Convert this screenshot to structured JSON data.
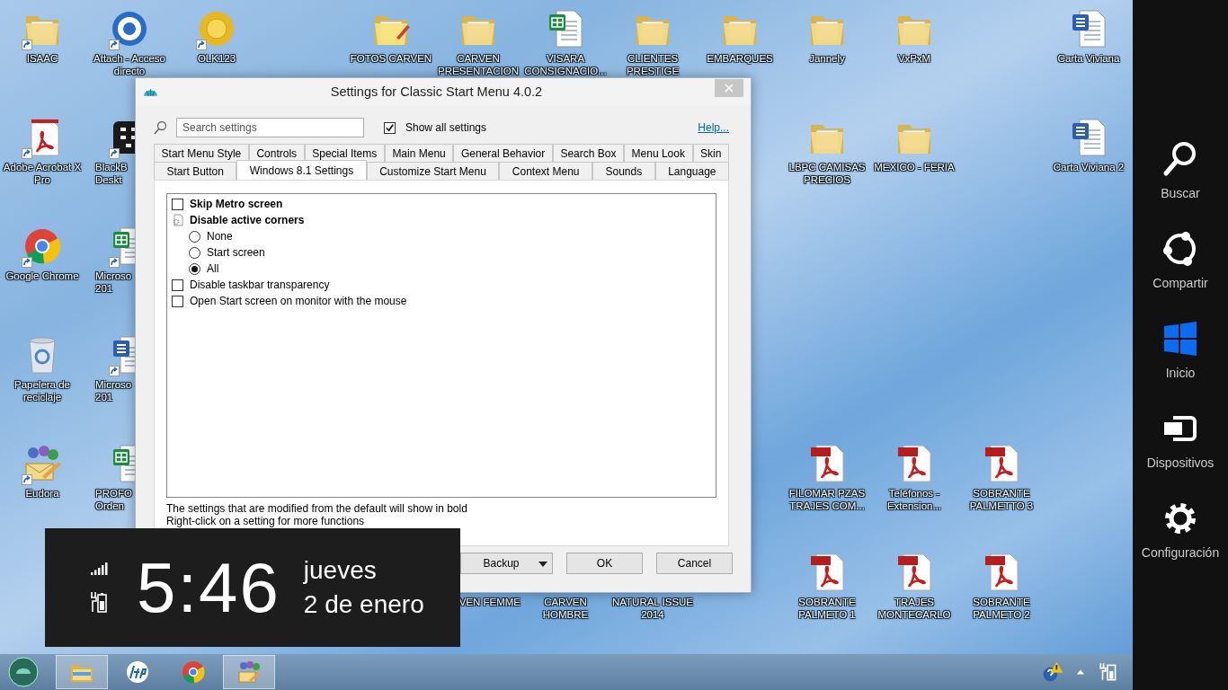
{
  "desktop_icons": [
    {
      "lines": [
        "ISAAC"
      ],
      "kind": "folder",
      "shortcut": true
    },
    {
      "lines": [
        "Attach - Acceso",
        "directo"
      ],
      "kind": "lifebuoy",
      "shortcut": true
    },
    {
      "lines": [
        "OLK123"
      ],
      "kind": "disc",
      "shortcut": true
    },
    {
      "lines": [
        "FOTOS CARVEN"
      ],
      "kind": "image-folder",
      "shortcut": false
    },
    {
      "lines": [
        "CARVEN",
        "PRESENTACION"
      ],
      "kind": "folder",
      "shortcut": false
    },
    {
      "lines": [
        "VISARA",
        "CONSIGNACIO..."
      ],
      "kind": "excel",
      "shortcut": false
    },
    {
      "lines": [
        "CLIENTES",
        "PRESTIGE"
      ],
      "kind": "folder",
      "shortcut": false
    },
    {
      "lines": [
        "EMBARQUES"
      ],
      "kind": "folder",
      "shortcut": false
    },
    {
      "lines": [
        "Jannely"
      ],
      "kind": "folder",
      "shortcut": false
    },
    {
      "lines": [
        "VxPxM"
      ],
      "kind": "folder",
      "shortcut": false
    },
    {
      "lines": [
        "Carta Viviana"
      ],
      "kind": "word",
      "shortcut": false
    },
    {
      "lines": [
        "Adobe Acrobat X",
        "Pro"
      ],
      "kind": "acrobat",
      "shortcut": true
    },
    {
      "lines": [
        "BlackB",
        "Deskt"
      ],
      "kind": "phone-app",
      "shortcut": true
    },
    {
      "lines": [
        "LBPC CAMISAS",
        "PRECIOS"
      ],
      "kind": "folder",
      "shortcut": false
    },
    {
      "lines": [
        "MEXICO - FERIA"
      ],
      "kind": "folder",
      "shortcut": false
    },
    {
      "lines": [
        "Carta Viviana 2"
      ],
      "kind": "word",
      "shortcut": false
    },
    {
      "lines": [
        "Google Chrome"
      ],
      "kind": "browser",
      "shortcut": true
    },
    {
      "lines": [
        "Microso",
        "201"
      ],
      "kind": "excel",
      "shortcut": true
    },
    {
      "lines": [
        "Papelera de",
        "reciclaje"
      ],
      "kind": "recycle",
      "shortcut": false
    },
    {
      "lines": [
        "Microso",
        "201"
      ],
      "kind": "word",
      "shortcut": true
    },
    {
      "lines": [
        "Eudora"
      ],
      "kind": "mail-app",
      "shortcut": true
    },
    {
      "lines": [
        "PROFO",
        "Orden"
      ],
      "kind": "excel",
      "shortcut": false
    },
    {
      "lines": [
        "FILOMAR PZAS",
        "TRAJES COM..."
      ],
      "kind": "pdf",
      "shortcut": false
    },
    {
      "lines": [
        "Teléfonos -",
        "Extension..."
      ],
      "kind": "pdf",
      "shortcut": false
    },
    {
      "lines": [
        "SOBRANTE",
        "PALMETTO 3"
      ],
      "kind": "pdf",
      "shortcut": false
    },
    {
      "lines": [
        "VEN FEMME"
      ],
      "kind": "folder",
      "shortcut": false
    },
    {
      "lines": [
        "CARVEN",
        "HOMBRE"
      ],
      "kind": "folder",
      "shortcut": false
    },
    {
      "lines": [
        "NATURAL ISSUE",
        "2014"
      ],
      "kind": "folder",
      "shortcut": false
    },
    {
      "lines": [
        "SOBRANTE",
        "PALMETO 1"
      ],
      "kind": "pdf",
      "shortcut": false
    },
    {
      "lines": [
        "TRAJES",
        "MONTECARLO"
      ],
      "kind": "pdf",
      "shortcut": false
    },
    {
      "lines": [
        "SOBRANTE",
        "PALMETO 2"
      ],
      "kind": "pdf",
      "shortcut": false
    }
  ],
  "dialog": {
    "title": "Settings for Classic Start Menu 4.0.2",
    "search": {
      "placeholder": "Search settings"
    },
    "show_all": {
      "label": "Show all settings",
      "checked": true
    },
    "help_link": "Help...",
    "tab_rows": [
      {
        "tabs": [
          {
            "label": "Start Menu Style",
            "selected": false
          },
          {
            "label": "Controls",
            "selected": false
          },
          {
            "label": "Special Items",
            "selected": false
          },
          {
            "label": "Main Menu",
            "selected": false
          },
          {
            "label": "General Behavior",
            "selected": false
          },
          {
            "label": "Search Box",
            "selected": false
          },
          {
            "label": "Menu Look",
            "selected": false
          },
          {
            "label": "Skin",
            "selected": false
          }
        ]
      },
      {
        "tabs": [
          {
            "label": "Start Button",
            "selected": false
          },
          {
            "label": "Windows 8.1 Settings",
            "selected": true
          },
          {
            "label": "Customize Start Menu",
            "selected": false
          },
          {
            "label": "Context Menu",
            "selected": false
          },
          {
            "label": "Sounds",
            "selected": false
          },
          {
            "label": "Language",
            "selected": false
          }
        ]
      }
    ],
    "settings": [
      {
        "kind": "checkbox",
        "label": "Skip Metro screen",
        "checked": false,
        "modified": true
      },
      {
        "kind": "group",
        "label": "Disable active corners",
        "modified": true,
        "children": [
          {
            "kind": "radio",
            "label": "None",
            "selected": false
          },
          {
            "kind": "radio",
            "label": "Start screen",
            "selected": false
          },
          {
            "kind": "radio",
            "label": "All",
            "selected": true
          }
        ]
      },
      {
        "kind": "checkbox",
        "label": "Disable taskbar transparency",
        "checked": false,
        "modified": false
      },
      {
        "kind": "checkbox",
        "label": "Open Start screen on monitor with the mouse",
        "checked": false,
        "modified": false
      }
    ],
    "notes": [
      "The settings that are modified from the default will show in bold",
      "Right-click on a setting for more functions"
    ],
    "buttons": [
      {
        "label": "Backup",
        "kind": "split"
      },
      {
        "label": "OK",
        "kind": "push"
      },
      {
        "label": "Cancel",
        "kind": "push"
      }
    ]
  },
  "clock": {
    "time": "5:46",
    "weekday": "jueves",
    "date": "2 de enero"
  },
  "taskbar": {
    "buttons": [
      {
        "kind": "explorer",
        "running": true
      },
      {
        "kind": "hp",
        "running": false
      },
      {
        "kind": "browser",
        "running": false
      },
      {
        "kind": "mail-app",
        "running": true
      }
    ]
  },
  "charms": [
    {
      "label": "Buscar",
      "kind": "search"
    },
    {
      "label": "Compartir",
      "kind": "share"
    },
    {
      "label": "Inicio",
      "kind": "start"
    },
    {
      "label": "Dispositivos",
      "kind": "devices"
    },
    {
      "label": "Configuración",
      "kind": "settings"
    }
  ]
}
